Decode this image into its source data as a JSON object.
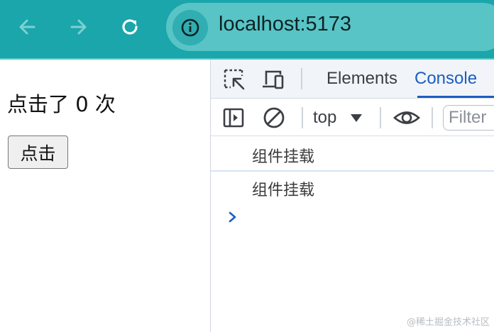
{
  "browser": {
    "url": "localhost:5173",
    "icons": {
      "back": "arrow-left-icon",
      "forward": "arrow-right-icon",
      "reload": "reload-icon",
      "site_info": "info-icon"
    },
    "colors": {
      "bar": "#1aa6aa",
      "omnibox": "#58c4c6"
    }
  },
  "page": {
    "count_text": "点击了 0 次",
    "button_label": "点击"
  },
  "devtools": {
    "tabs": [
      {
        "label": "Elements",
        "active": false
      },
      {
        "label": "Console",
        "active": true
      }
    ],
    "toolbar": {
      "context": "top",
      "filter_placeholder": "Filter"
    },
    "console_messages": [
      "组件挂载",
      "组件挂载"
    ],
    "accent_color": "#1a5ec0"
  },
  "watermark": "@稀土掘金技术社区"
}
